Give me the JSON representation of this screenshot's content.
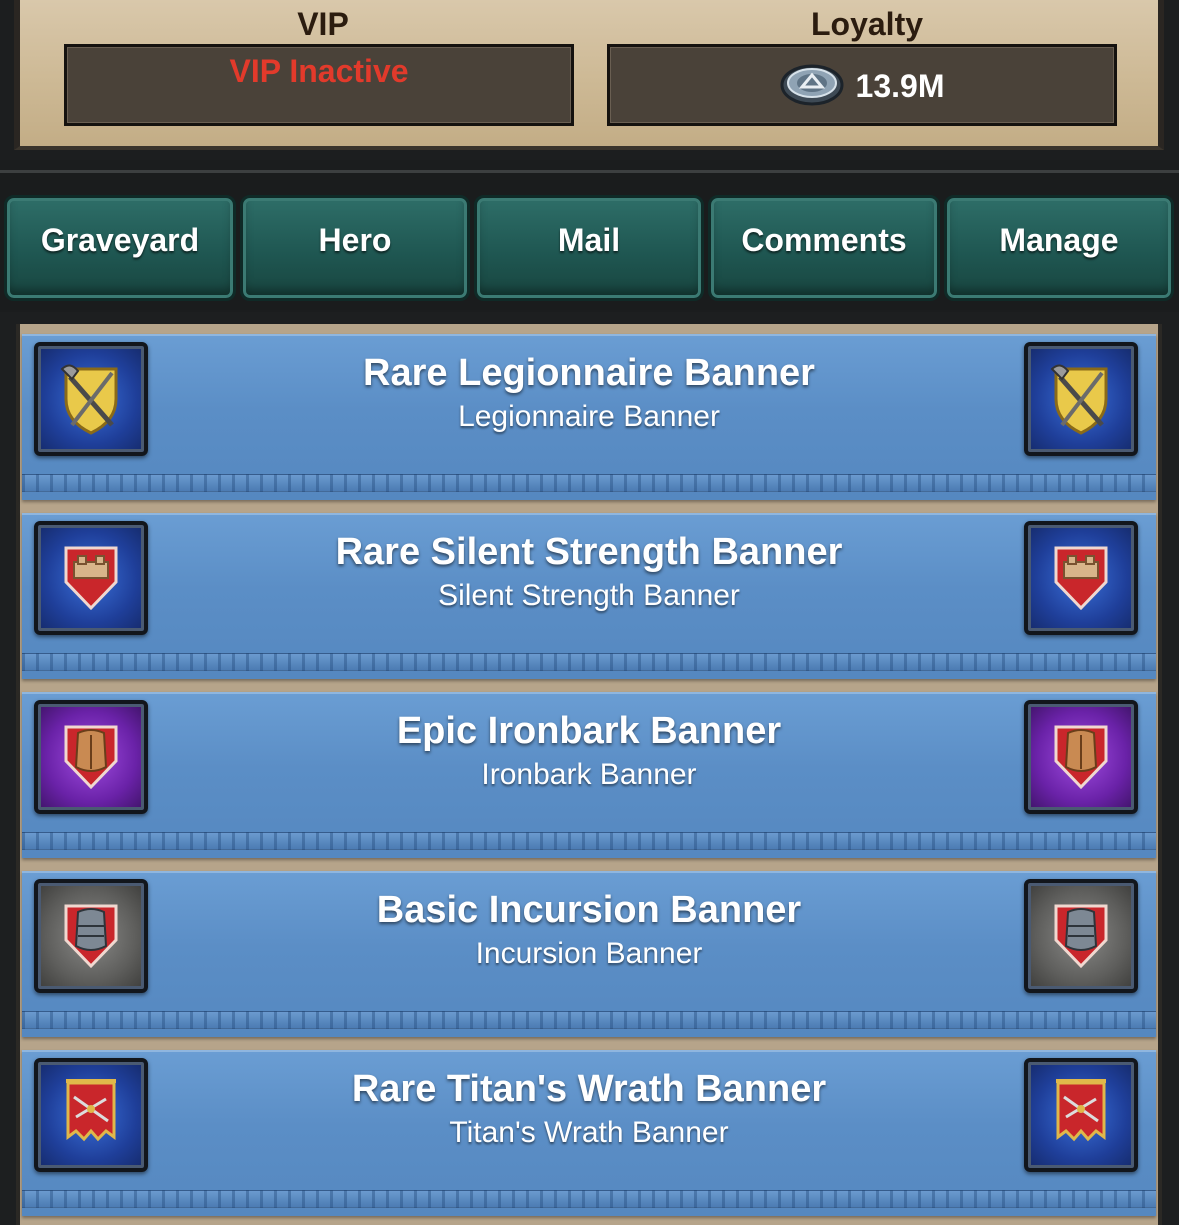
{
  "header": {
    "vip_label": "VIP",
    "vip_status": "VIP Inactive",
    "loyalty_label": "Loyalty",
    "loyalty_value": "13.9M",
    "loyalty_icon": "loyalty-token-icon",
    "vip_status_color": "#e23a2b"
  },
  "tabs": [
    {
      "label": "Graveyard"
    },
    {
      "label": "Hero"
    },
    {
      "label": "Mail"
    },
    {
      "label": "Comments"
    },
    {
      "label": "Manage"
    }
  ],
  "banners": [
    {
      "title": "Rare Legionnaire Banner",
      "subtitle": "Legionnaire Banner",
      "icon": "axe-sword-shield-icon",
      "rarity_color": "blue"
    },
    {
      "title": "Rare Silent Strength Banner",
      "subtitle": "Silent Strength Banner",
      "icon": "fortress-shield-icon",
      "rarity_color": "blue"
    },
    {
      "title": "Epic Ironbark Banner",
      "subtitle": "Ironbark Banner",
      "icon": "bronze-armor-shield-icon",
      "rarity_color": "purple"
    },
    {
      "title": "Basic Incursion Banner",
      "subtitle": "Incursion Banner",
      "icon": "steel-armor-shield-icon",
      "rarity_color": "gray"
    },
    {
      "title": "Rare Titan's Wrath Banner",
      "subtitle": "Titan's Wrath Banner",
      "icon": "crossbow-pennant-icon",
      "rarity_color": "blue"
    }
  ]
}
